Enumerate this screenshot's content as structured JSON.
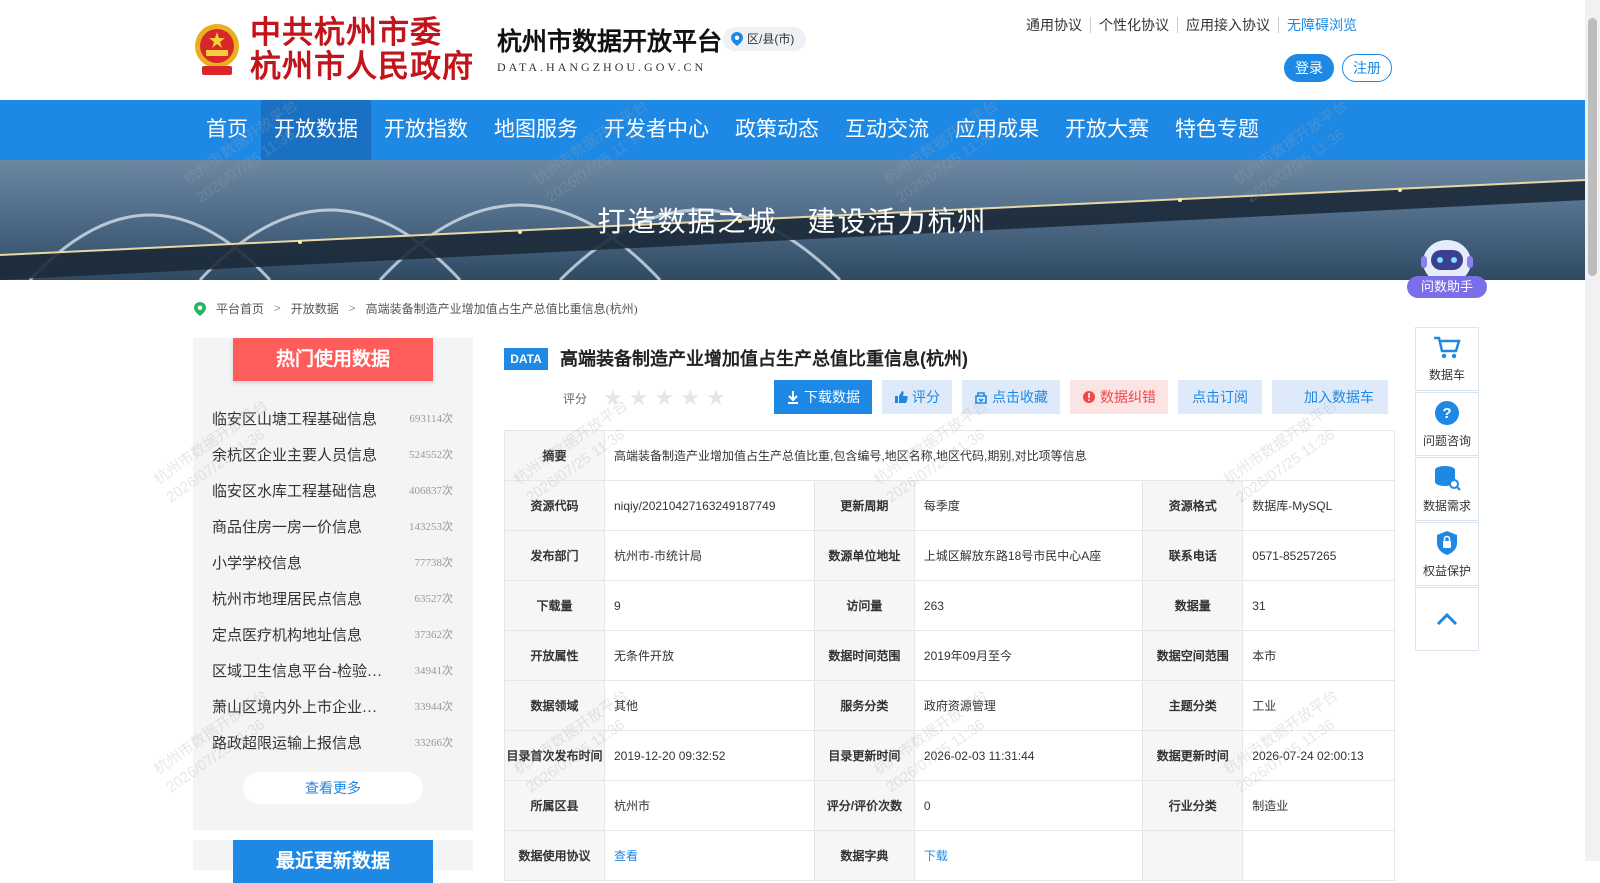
{
  "header": {
    "gov_name_line1": "中共杭州市委",
    "gov_name_line2": "杭州市人民政府",
    "site_title": "杭州市数据开放平台",
    "site_domain": "DATA.HANGZHOU.GOV.CN",
    "region_label": "区/县(市)",
    "top_links": [
      "通用协议",
      "个性化协议",
      "应用接入协议",
      "无障碍浏览"
    ],
    "login_label": "登录",
    "register_label": "注册"
  },
  "nav": {
    "items": [
      "首页",
      "开放数据",
      "开放指数",
      "地图服务",
      "开发者中心",
      "政策动态",
      "互动交流",
      "应用成果",
      "开放大赛",
      "特色专题"
    ],
    "active_index": 1
  },
  "banner": {
    "slogan": "打造数据之城　建设活力杭州"
  },
  "breadcrumb": {
    "items": [
      "平台首页",
      "开放数据",
      "高端装备制造产业增加值占生产总值比重信息(杭州)"
    ],
    "separator": ">"
  },
  "hot": {
    "title": "热门使用数据",
    "items": [
      {
        "name": "临安区山塘工程基础信息",
        "count": "693114次"
      },
      {
        "name": "余杭区企业主要人员信息",
        "count": "524552次"
      },
      {
        "name": "临安区水库工程基础信息",
        "count": "406837次"
      },
      {
        "name": "商品住房一房一价信息",
        "count": "143253次"
      },
      {
        "name": "小学学校信息",
        "count": "77738次"
      },
      {
        "name": "杭州市地理居民点信息",
        "count": "63527次"
      },
      {
        "name": "定点医疗机构地址信息",
        "count": "37362次"
      },
      {
        "name": "区域卫生信息平台-检验…",
        "count": "34941次"
      },
      {
        "name": "萧山区境内外上市企业名…",
        "count": "33944次"
      },
      {
        "name": "路政超限运输上报信息",
        "count": "33266次"
      }
    ],
    "more_label": "查看更多"
  },
  "recent": {
    "title": "最近更新数据"
  },
  "dataset": {
    "badge": "DATA",
    "title": "高端装备制造产业增加值占生产总值比重信息(杭州)",
    "rating_label": "评分",
    "stars_filled": 0,
    "stars_total": 5,
    "actions": [
      "下载数据",
      "评分",
      "点击收藏",
      "数据纠错",
      "点击订阅",
      "加入数据车"
    ]
  },
  "info": {
    "summary_label": "摘要",
    "summary": "高端装备制造产业增加值占生产总值比重,包含编号,地区名称,地区代码,期别,对比项等信息",
    "rows": [
      [
        [
          "资源代码",
          "niqiy/20210427163249187749"
        ],
        [
          "更新周期",
          "每季度"
        ],
        [
          "资源格式",
          "数据库-MySQL"
        ]
      ],
      [
        [
          "发布部门",
          "杭州市-市统计局"
        ],
        [
          "数源单位地址",
          "上城区解放东路18号市民中心A座"
        ],
        [
          "联系电话",
          "0571-85257265"
        ]
      ],
      [
        [
          "下载量",
          "9"
        ],
        [
          "访问量",
          "263"
        ],
        [
          "数据量",
          "31"
        ]
      ],
      [
        [
          "开放属性",
          "无条件开放"
        ],
        [
          "数据时间范围",
          "2019年09月至今"
        ],
        [
          "数据空间范围",
          "本市"
        ]
      ],
      [
        [
          "数据领域",
          "其他"
        ],
        [
          "服务分类",
          "政府资源管理"
        ],
        [
          "主题分类",
          "工业"
        ]
      ],
      [
        [
          "目录首次发布时间",
          "2019-12-20 09:32:52"
        ],
        [
          "目录更新时间",
          "2026-02-03 11:31:44"
        ],
        [
          "数据更新时间",
          "2026-07-24 02:00:13"
        ]
      ],
      [
        [
          "所属区县",
          "杭州市"
        ],
        [
          "评分/评价次数",
          "0"
        ],
        [
          "行业分类",
          "制造业"
        ]
      ]
    ],
    "agreement_label": "数据使用协议",
    "agreement_link": "查看",
    "dictionary_label": "数据字典",
    "dictionary_link": "下载"
  },
  "float": {
    "assistant": "问数助手",
    "items": [
      "数据车",
      "问题咨询",
      "数据需求",
      "权益保护"
    ]
  },
  "watermark": {
    "line1": "杭州市数据开放平台",
    "line2": "2026/07/25 11:36"
  },
  "colors": {
    "primary": "#1e88e5",
    "nav_active": "#1a71c4",
    "hot_red": "#ff5c5c",
    "gov_red": "#c2151b"
  }
}
